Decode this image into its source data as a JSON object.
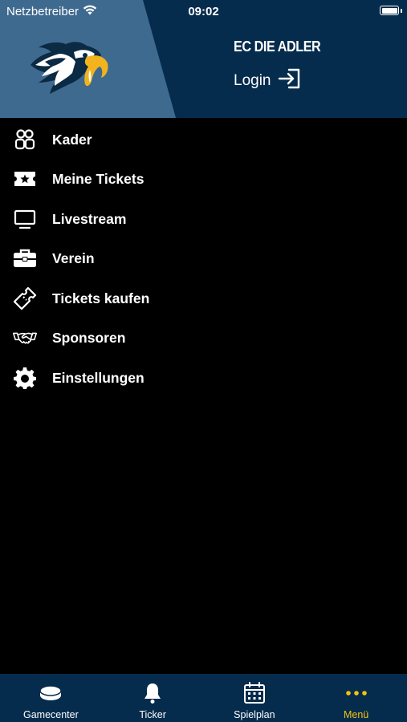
{
  "status_bar": {
    "carrier": "Netzbetreiber",
    "time": "09:02",
    "battery_level": 1.0,
    "wifi_icon": "wifi-icon"
  },
  "header": {
    "club_name": "EC DIE ADLER",
    "login_label": "Login",
    "logo_icon": "eagle-logo",
    "login_icon": "login-arrow-icon",
    "colors": {
      "header_dark": "#062c4d",
      "header_light": "#3f6a8f",
      "beak": "#f2b31c"
    }
  },
  "menu": {
    "items": [
      {
        "label": "Kader",
        "icon": "team-icon"
      },
      {
        "label": "Meine Tickets",
        "icon": "ticket-star-icon"
      },
      {
        "label": "Livestream",
        "icon": "monitor-icon"
      },
      {
        "label": "Verein",
        "icon": "briefcase-icon"
      },
      {
        "label": "Tickets kaufen",
        "icon": "ticket-icon"
      },
      {
        "label": "Sponsoren",
        "icon": "handshake-icon"
      },
      {
        "label": "Einstellungen",
        "icon": "gear-icon"
      }
    ]
  },
  "tabbar": {
    "active_tab": "Menü",
    "accent_color": "#f2c40f",
    "tabs": [
      {
        "label": "Gamecenter",
        "icon": "puck-icon"
      },
      {
        "label": "Ticker",
        "icon": "bell-icon"
      },
      {
        "label": "Spielplan",
        "icon": "calendar-icon"
      },
      {
        "label": "Menü",
        "icon": "more-dots-icon"
      }
    ]
  }
}
